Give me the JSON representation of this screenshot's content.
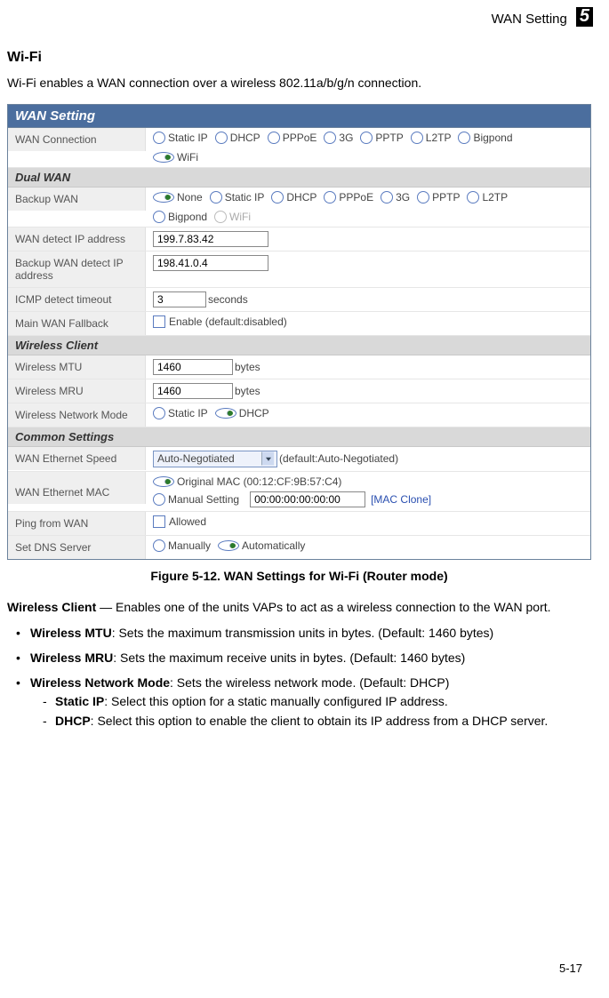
{
  "header": {
    "title": "WAN Setting",
    "chapter": "5"
  },
  "section": {
    "title": "Wi-Fi",
    "lead": "Wi-Fi enables a WAN connection over a wireless 802.11a/b/g/n connection."
  },
  "panel": {
    "title": "WAN Setting",
    "wan_connection": {
      "label": "WAN Connection",
      "options": [
        "Static IP",
        "DHCP",
        "PPPoE",
        "3G",
        "PPTP",
        "L2TP",
        "Bigpond",
        "WiFi"
      ],
      "selected": "WiFi"
    },
    "dual_wan": {
      "heading": "Dual WAN",
      "backup_wan": {
        "label": "Backup WAN",
        "options": [
          "None",
          "Static IP",
          "DHCP",
          "PPPoE",
          "3G",
          "PPTP",
          "L2TP",
          "Bigpond",
          "WiFi"
        ],
        "selected": "None",
        "disabled_option": "WiFi"
      },
      "wan_detect_ip": {
        "label": "WAN detect IP address",
        "value": "199.7.83.42"
      },
      "backup_wan_detect_ip": {
        "label": "Backup WAN detect IP address",
        "value": "198.41.0.4"
      },
      "icmp_timeout": {
        "label": "ICMP detect timeout",
        "value": "3",
        "unit": "seconds"
      },
      "fallback": {
        "label": "Main WAN Fallback",
        "text": "Enable (default:disabled)",
        "checked": false
      }
    },
    "wireless_client": {
      "heading": "Wireless Client",
      "mtu": {
        "label": "Wireless MTU",
        "value": "1460",
        "unit": "bytes"
      },
      "mru": {
        "label": "Wireless MRU",
        "value": "1460",
        "unit": "bytes"
      },
      "mode": {
        "label": "Wireless Network Mode",
        "options": [
          "Static IP",
          "DHCP"
        ],
        "selected": "DHCP"
      }
    },
    "common_settings": {
      "heading": "Common Settings",
      "speed": {
        "label": "WAN Ethernet Speed",
        "value": "Auto-Negotiated",
        "hint": "(default:Auto-Negotiated)"
      },
      "mac": {
        "label": "WAN Ethernet MAC",
        "original_label": "Original MAC (00:12:CF:9B:57:C4)",
        "manual_label": "Manual Setting",
        "manual_value": "00:00:00:00:00:00",
        "clone_link": "[MAC Clone]",
        "selected": "original"
      },
      "ping": {
        "label": "Ping from WAN",
        "text": "Allowed",
        "checked": false
      },
      "dns": {
        "label": "Set DNS Server",
        "options": [
          "Manually",
          "Automatically"
        ],
        "selected": "Automatically"
      }
    }
  },
  "figure_caption": "Figure 5-12.   WAN Settings for Wi-Fi (Router mode)",
  "body": {
    "intro_bold": "Wireless Client",
    "intro_rest": " — Enables one of the units VAPs to act as a wireless connection to the WAN port.",
    "mtu_bold": "Wireless MTU",
    "mtu_rest": ": Sets the maximum transmission units in bytes. (Default: 1460 bytes)",
    "mru_bold": "Wireless MRU",
    "mru_rest": ": Sets the maximum receive units in bytes. (Default: 1460 bytes)",
    "mode_bold": "Wireless Network Mode",
    "mode_rest": ": Sets the wireless network mode. (Default: DHCP)",
    "static_bold": "Static IP",
    "static_rest": ": Select this option for a static manually configured IP address.",
    "dhcp_bold": "DHCP",
    "dhcp_rest": ": Select this option to enable the client to obtain its IP address from a DHCP server."
  },
  "footer": "5-17"
}
